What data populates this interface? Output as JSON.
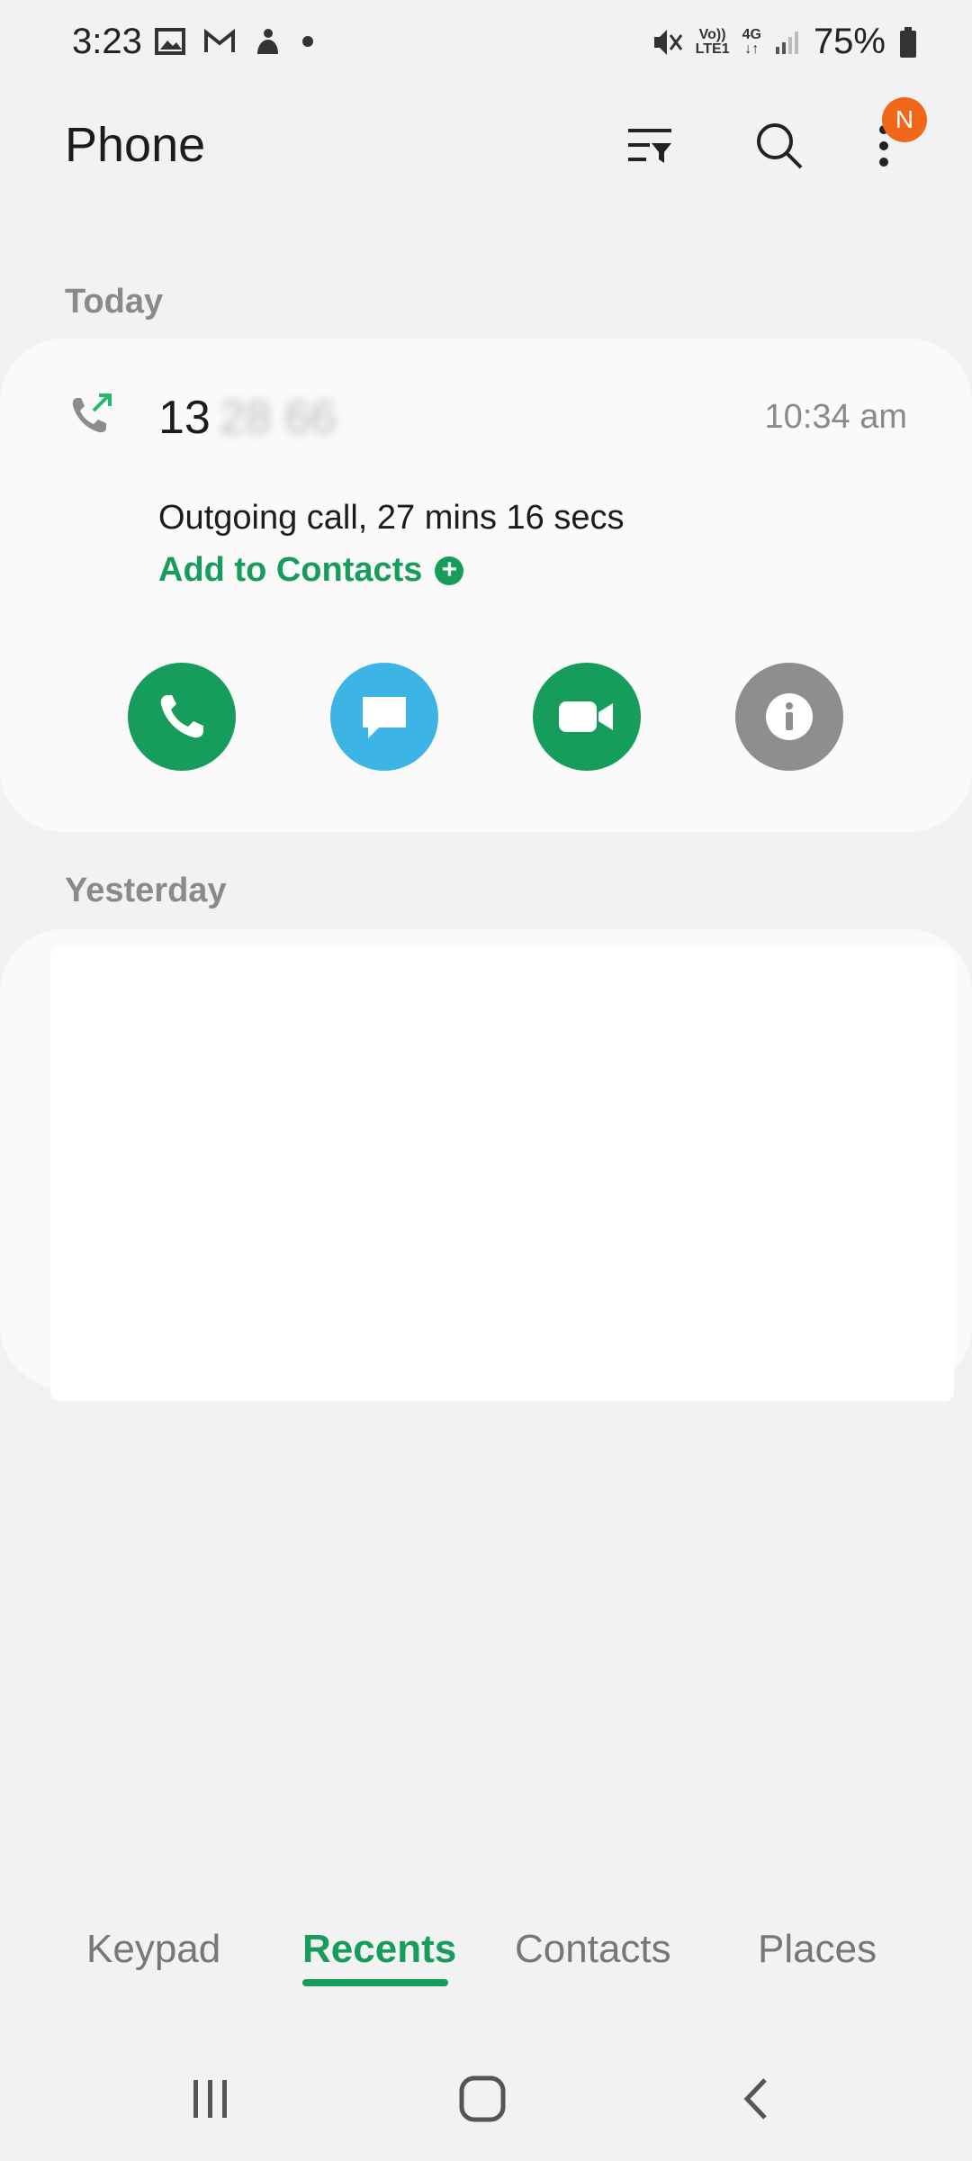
{
  "status_bar": {
    "time": "3:23",
    "battery": "75%",
    "volte_top": "Vo))",
    "volte_bottom": "LTE1",
    "net_type": "4G"
  },
  "app_bar": {
    "title": "Phone",
    "badge": "N"
  },
  "sections": {
    "today": "Today",
    "yesterday": "Yesterday"
  },
  "call": {
    "number_visible": "13",
    "number_hidden": "28 66",
    "time": "10:34 am",
    "description": "Outgoing call, 27 mins 16 secs",
    "add_contacts": "Add to Contacts"
  },
  "colors": {
    "accent": "#169c5b",
    "message": "#3cb4e5",
    "info": "#8e8e8e",
    "badge": "#f0671a"
  },
  "tabs": [
    {
      "label": "Keypad",
      "active": false
    },
    {
      "label": "Recents",
      "active": true
    },
    {
      "label": "Contacts",
      "active": false
    },
    {
      "label": "Places",
      "active": false
    }
  ]
}
